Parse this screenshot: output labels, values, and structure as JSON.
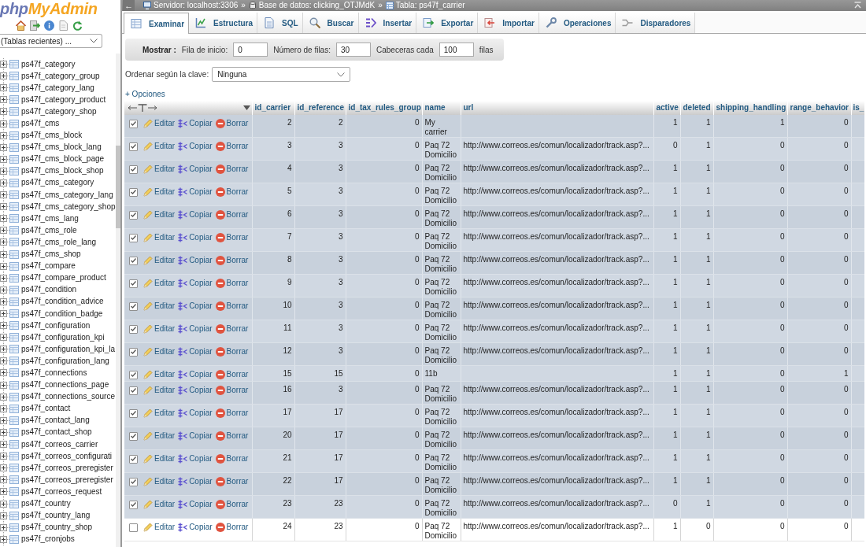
{
  "sidebar": {
    "logo": {
      "prefix": "php",
      "name": "MyAdmin"
    },
    "recent_tables": {
      "value": "(Tablas recientes) ..."
    },
    "tables": [
      {
        "name": "ps47f_category",
        "expanded": false
      },
      {
        "name": "ps47f_category_group",
        "expanded": false
      },
      {
        "name": "ps47f_category_lang",
        "expanded": false
      },
      {
        "name": "ps47f_category_product",
        "expanded": false
      },
      {
        "name": "ps47f_category_shop",
        "expanded": false
      },
      {
        "name": "ps47f_cms",
        "expanded": false
      },
      {
        "name": "ps47f_cms_block",
        "expanded": false
      },
      {
        "name": "ps47f_cms_block_lang",
        "expanded": false
      },
      {
        "name": "ps47f_cms_block_page",
        "expanded": false
      },
      {
        "name": "ps47f_cms_block_shop",
        "expanded": false
      },
      {
        "name": "ps47f_cms_category",
        "expanded": false
      },
      {
        "name": "ps47f_cms_category_lang",
        "expanded": false
      },
      {
        "name": "ps47f_cms_category_shop",
        "expanded": false
      },
      {
        "name": "ps47f_cms_lang",
        "expanded": false
      },
      {
        "name": "ps47f_cms_role",
        "expanded": false
      },
      {
        "name": "ps47f_cms_role_lang",
        "expanded": false
      },
      {
        "name": "ps47f_cms_shop",
        "expanded": false
      },
      {
        "name": "ps47f_compare",
        "expanded": false
      },
      {
        "name": "ps47f_compare_product",
        "expanded": false
      },
      {
        "name": "ps47f_condition",
        "expanded": false
      },
      {
        "name": "ps47f_condition_advice",
        "expanded": false
      },
      {
        "name": "ps47f_condition_badge",
        "expanded": false
      },
      {
        "name": "ps47f_configuration",
        "expanded": false
      },
      {
        "name": "ps47f_configuration_kpi",
        "expanded": false
      },
      {
        "name": "ps47f_configuration_kpi_la",
        "expanded": false
      },
      {
        "name": "ps47f_configuration_lang",
        "expanded": false
      },
      {
        "name": "ps47f_connections",
        "expanded": false
      },
      {
        "name": "ps47f_connections_page",
        "expanded": false
      },
      {
        "name": "ps47f_connections_source",
        "expanded": false
      },
      {
        "name": "ps47f_contact",
        "expanded": false
      },
      {
        "name": "ps47f_contact_lang",
        "expanded": false
      },
      {
        "name": "ps47f_contact_shop",
        "expanded": false
      },
      {
        "name": "ps47f_correos_carrier",
        "expanded": false
      },
      {
        "name": "ps47f_correos_configurati",
        "expanded": false
      },
      {
        "name": "ps47f_correos_preregister",
        "expanded": false
      },
      {
        "name": "ps47f_correos_preregister",
        "expanded": false
      },
      {
        "name": "ps47f_correos_request",
        "expanded": false
      },
      {
        "name": "ps47f_country",
        "expanded": false
      },
      {
        "name": "ps47f_country_lang",
        "expanded": false
      },
      {
        "name": "ps47f_country_shop",
        "expanded": false
      },
      {
        "name": "ps47f_cronjobs",
        "expanded": false
      }
    ]
  },
  "breadcrumb": {
    "collapse": "←",
    "items": [
      {
        "kind": "server",
        "label": "Servidor: localhost:3306"
      },
      {
        "kind": "separator",
        "label": "»"
      },
      {
        "kind": "database",
        "label": "Base de datos: clicking_OTJMdK"
      },
      {
        "kind": "separator",
        "label": "»"
      },
      {
        "kind": "table",
        "label": "Tabla: ps47f_carrier"
      }
    ]
  },
  "tabs": [
    {
      "label": "Examinar",
      "kind": "browse",
      "selected": true
    },
    {
      "label": "Estructura",
      "kind": "structure",
      "selected": false
    },
    {
      "label": "SQL",
      "kind": "sql",
      "selected": false
    },
    {
      "label": "Buscar",
      "kind": "search",
      "selected": false
    },
    {
      "label": "Insertar",
      "kind": "insert",
      "selected": false
    },
    {
      "label": "Exportar",
      "kind": "export",
      "selected": false
    },
    {
      "label": "Importar",
      "kind": "import",
      "selected": false
    },
    {
      "label": "Operaciones",
      "kind": "operations",
      "selected": false
    },
    {
      "label": "Disparadores",
      "kind": "triggers",
      "selected": false
    }
  ],
  "display_options": {
    "title": "Mostrar :",
    "fields": [
      {
        "label": "Fila de inicio:",
        "value": "0"
      },
      {
        "label": "Número de filas:",
        "value": "30"
      },
      {
        "label": "Cabeceras cada",
        "value": "100"
      }
    ],
    "suffix": "filas"
  },
  "sort": {
    "label": "Ordenar según la clave:",
    "value": "Ninguna"
  },
  "options_link": "+ Opciones",
  "table": {
    "columns": [
      "id_carrier",
      "id_reference",
      "id_tax_rules_group",
      "name",
      "url",
      "active",
      "deleted",
      "shipping_handling",
      "range_behavior",
      "is_"
    ],
    "rows": [
      {
        "checked": true,
        "actions": [
          {
            "kind": "edit",
            "label": "Editar"
          },
          {
            "kind": "copy",
            "label": "Copiar"
          },
          {
            "kind": "delete",
            "label": "Borrar"
          }
        ],
        "id_carrier": "2",
        "id_reference": "2",
        "id_tax_rules_group": "0",
        "name": "My carrier",
        "active": "1",
        "deleted": "1",
        "shipping_handling": "1",
        "range_behavior": "0"
      },
      {
        "checked": true,
        "actions": [
          {
            "kind": "edit",
            "label": "Editar"
          },
          {
            "kind": "copy",
            "label": "Copiar"
          },
          {
            "kind": "delete",
            "label": "Borrar"
          }
        ],
        "id_carrier": "3",
        "id_reference": "3",
        "id_tax_rules_group": "0",
        "name": "Paq 72 Domicilio",
        "url": "http://www.correos.es/comun/localizador/track.asp?...",
        "active": "0",
        "deleted": "1",
        "shipping_handling": "0",
        "range_behavior": "0"
      },
      {
        "checked": true,
        "actions": [
          {
            "kind": "edit",
            "label": "Editar"
          },
          {
            "kind": "copy",
            "label": "Copiar"
          },
          {
            "kind": "delete",
            "label": "Borrar"
          }
        ],
        "id_carrier": "4",
        "id_reference": "3",
        "id_tax_rules_group": "0",
        "name": "Paq 72 Domicilio",
        "url": "http://www.correos.es/comun/localizador/track.asp?...",
        "active": "1",
        "deleted": "1",
        "shipping_handling": "0",
        "range_behavior": "0"
      },
      {
        "checked": true,
        "actions": [
          {
            "kind": "edit",
            "label": "Editar"
          },
          {
            "kind": "copy",
            "label": "Copiar"
          },
          {
            "kind": "delete",
            "label": "Borrar"
          }
        ],
        "id_carrier": "5",
        "id_reference": "3",
        "id_tax_rules_group": "0",
        "name": "Paq 72 Domicilio",
        "url": "http://www.correos.es/comun/localizador/track.asp?...",
        "active": "1",
        "deleted": "1",
        "shipping_handling": "0",
        "range_behavior": "0"
      },
      {
        "checked": true,
        "actions": [
          {
            "kind": "edit",
            "label": "Editar"
          },
          {
            "kind": "copy",
            "label": "Copiar"
          },
          {
            "kind": "delete",
            "label": "Borrar"
          }
        ],
        "id_carrier": "6",
        "id_reference": "3",
        "id_tax_rules_group": "0",
        "name": "Paq 72 Domicilio",
        "url": "http://www.correos.es/comun/localizador/track.asp?...",
        "active": "1",
        "deleted": "1",
        "shipping_handling": "0",
        "range_behavior": "0"
      },
      {
        "checked": true,
        "actions": [
          {
            "kind": "edit",
            "label": "Editar"
          },
          {
            "kind": "copy",
            "label": "Copiar"
          },
          {
            "kind": "delete",
            "label": "Borrar"
          }
        ],
        "id_carrier": "7",
        "id_reference": "3",
        "id_tax_rules_group": "0",
        "name": "Paq 72 Domicilio",
        "url": "http://www.correos.es/comun/localizador/track.asp?...",
        "active": "1",
        "deleted": "1",
        "shipping_handling": "0",
        "range_behavior": "0"
      },
      {
        "checked": true,
        "actions": [
          {
            "kind": "edit",
            "label": "Editar"
          },
          {
            "kind": "copy",
            "label": "Copiar"
          },
          {
            "kind": "delete",
            "label": "Borrar"
          }
        ],
        "id_carrier": "8",
        "id_reference": "3",
        "id_tax_rules_group": "0",
        "name": "Paq 72 Domicilio",
        "url": "http://www.correos.es/comun/localizador/track.asp?...",
        "active": "1",
        "deleted": "1",
        "shipping_handling": "0",
        "range_behavior": "0"
      },
      {
        "checked": true,
        "actions": [
          {
            "kind": "edit",
            "label": "Editar"
          },
          {
            "kind": "copy",
            "label": "Copiar"
          },
          {
            "kind": "delete",
            "label": "Borrar"
          }
        ],
        "id_carrier": "9",
        "id_reference": "3",
        "id_tax_rules_group": "0",
        "name": "Paq 72 Domicilio",
        "url": "http://www.correos.es/comun/localizador/track.asp?...",
        "active": "1",
        "deleted": "1",
        "shipping_handling": "0",
        "range_behavior": "0"
      },
      {
        "checked": true,
        "actions": [
          {
            "kind": "edit",
            "label": "Editar"
          },
          {
            "kind": "copy",
            "label": "Copiar"
          },
          {
            "kind": "delete",
            "label": "Borrar"
          }
        ],
        "id_carrier": "10",
        "id_reference": "3",
        "id_tax_rules_group": "0",
        "name": "Paq 72 Domicilio",
        "url": "http://www.correos.es/comun/localizador/track.asp?...",
        "active": "1",
        "deleted": "1",
        "shipping_handling": "0",
        "range_behavior": "0"
      },
      {
        "checked": true,
        "actions": [
          {
            "kind": "edit",
            "label": "Editar"
          },
          {
            "kind": "copy",
            "label": "Copiar"
          },
          {
            "kind": "delete",
            "label": "Borrar"
          }
        ],
        "id_carrier": "11",
        "id_reference": "3",
        "id_tax_rules_group": "0",
        "name": "Paq 72 Domicilio",
        "url": "http://www.correos.es/comun/localizador/track.asp?...",
        "active": "1",
        "deleted": "1",
        "shipping_handling": "0",
        "range_behavior": "0"
      },
      {
        "checked": true,
        "actions": [
          {
            "kind": "edit",
            "label": "Editar"
          },
          {
            "kind": "copy",
            "label": "Copiar"
          },
          {
            "kind": "delete",
            "label": "Borrar"
          }
        ],
        "id_carrier": "12",
        "id_reference": "3",
        "id_tax_rules_group": "0",
        "name": "Paq 72 Domicilio",
        "url": "http://www.correos.es/comun/localizador/track.asp?...",
        "active": "1",
        "deleted": "1",
        "shipping_handling": "0",
        "range_behavior": "0"
      },
      {
        "checked": true,
        "actions": [
          {
            "kind": "edit",
            "label": "Editar"
          },
          {
            "kind": "copy",
            "label": "Copiar"
          },
          {
            "kind": "delete",
            "label": "Borrar"
          }
        ],
        "id_carrier": "15",
        "id_reference": "15",
        "id_tax_rules_group": "0",
        "name": "11b",
        "active": "1",
        "deleted": "1",
        "shipping_handling": "0",
        "range_behavior": "1"
      },
      {
        "checked": true,
        "actions": [
          {
            "kind": "edit",
            "label": "Editar"
          },
          {
            "kind": "copy",
            "label": "Copiar"
          },
          {
            "kind": "delete",
            "label": "Borrar"
          }
        ],
        "id_carrier": "16",
        "id_reference": "3",
        "id_tax_rules_group": "0",
        "name": "Paq 72 Domicilio",
        "url": "http://www.correos.es/comun/localizador/track.asp?...",
        "active": "1",
        "deleted": "1",
        "shipping_handling": "0",
        "range_behavior": "0"
      },
      {
        "checked": true,
        "actions": [
          {
            "kind": "edit",
            "label": "Editar"
          },
          {
            "kind": "copy",
            "label": "Copiar"
          },
          {
            "kind": "delete",
            "label": "Borrar"
          }
        ],
        "id_carrier": "17",
        "id_reference": "17",
        "id_tax_rules_group": "0",
        "name": "Paq 72 Domicilio",
        "url": "http://www.correos.es/comun/localizador/track.asp?...",
        "active": "1",
        "deleted": "1",
        "shipping_handling": "0",
        "range_behavior": "0"
      },
      {
        "checked": true,
        "actions": [
          {
            "kind": "edit",
            "label": "Editar"
          },
          {
            "kind": "copy",
            "label": "Copiar"
          },
          {
            "kind": "delete",
            "label": "Borrar"
          }
        ],
        "id_carrier": "20",
        "id_reference": "17",
        "id_tax_rules_group": "0",
        "name": "Paq 72 Domicilio",
        "url": "http://www.correos.es/comun/localizador/track.asp?...",
        "active": "1",
        "deleted": "1",
        "shipping_handling": "0",
        "range_behavior": "0"
      },
      {
        "checked": true,
        "actions": [
          {
            "kind": "edit",
            "label": "Editar"
          },
          {
            "kind": "copy",
            "label": "Copiar"
          },
          {
            "kind": "delete",
            "label": "Borrar"
          }
        ],
        "id_carrier": "21",
        "id_reference": "17",
        "id_tax_rules_group": "0",
        "name": "Paq 72 Domicilio",
        "url": "http://www.correos.es/comun/localizador/track.asp?...",
        "active": "1",
        "deleted": "1",
        "shipping_handling": "0",
        "range_behavior": "0"
      },
      {
        "checked": true,
        "actions": [
          {
            "kind": "edit",
            "label": "Editar"
          },
          {
            "kind": "copy",
            "label": "Copiar"
          },
          {
            "kind": "delete",
            "label": "Borrar"
          }
        ],
        "id_carrier": "22",
        "id_reference": "17",
        "id_tax_rules_group": "0",
        "name": "Paq 72 Domicilio",
        "url": "http://www.correos.es/comun/localizador/track.asp?...",
        "active": "1",
        "deleted": "1",
        "shipping_handling": "0",
        "range_behavior": "0"
      },
      {
        "checked": true,
        "actions": [
          {
            "kind": "edit",
            "label": "Editar"
          },
          {
            "kind": "copy",
            "label": "Copiar"
          },
          {
            "kind": "delete",
            "label": "Borrar"
          }
        ],
        "id_carrier": "23",
        "id_reference": "23",
        "id_tax_rules_group": "0",
        "name": "Paq 72 Domicilio",
        "url": "http://www.correos.es/comun/localizador/track.asp?...",
        "active": "0",
        "deleted": "1",
        "shipping_handling": "0",
        "range_behavior": "0"
      },
      {
        "checked": false,
        "actions": [
          {
            "kind": "edit",
            "label": "Editar"
          },
          {
            "kind": "copy",
            "label": "Copiar"
          },
          {
            "kind": "delete",
            "label": "Borrar"
          }
        ],
        "id_carrier": "24",
        "id_reference": "23",
        "id_tax_rules_group": "0",
        "name": "Paq 72 Domicilio",
        "url": "http://www.correos.es/comun/localizador/track.asp?...",
        "active": "1",
        "deleted": "0",
        "shipping_handling": "0",
        "range_behavior": "0"
      }
    ]
  }
}
